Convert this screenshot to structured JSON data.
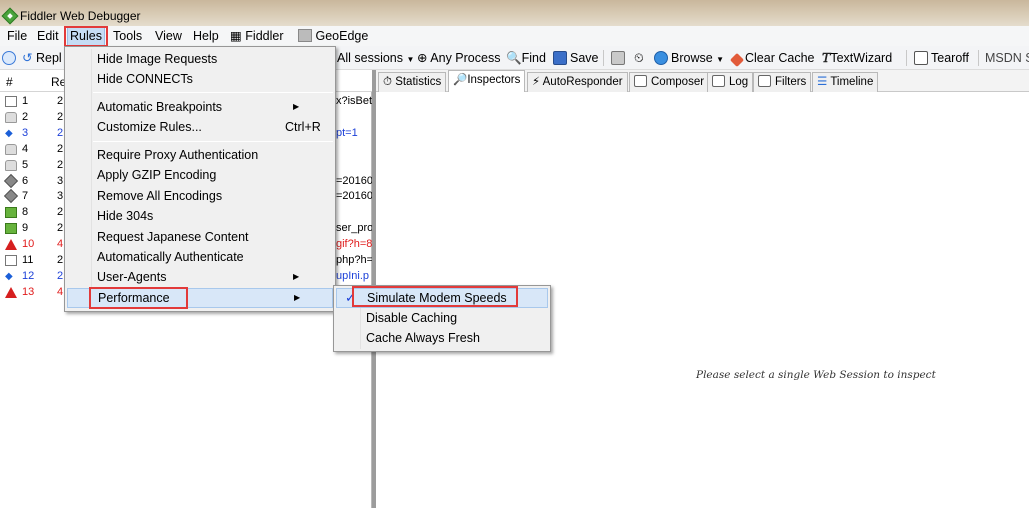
{
  "window": {
    "title": "Fiddler Web Debugger"
  },
  "menubar": [
    "File",
    "Edit",
    "Rules",
    "Tools",
    "View",
    "Help",
    "Fiddler",
    "GeoEdge"
  ],
  "toolbar": {
    "replay": "Repl",
    "sessions": "All sessions",
    "process": "Any Process",
    "find": "Find",
    "save": "Save",
    "browse": "Browse",
    "clear_cache": "Clear Cache",
    "textwizard": "TextWizard",
    "tearoff": "Tearoff",
    "msdn": "MSDN S"
  },
  "session_list": {
    "columns": [
      "#",
      "Re"
    ],
    "rows": [
      {
        "num": "1",
        "icon": "document-icon",
        "res": "2",
        "url": "x?isBet",
        "color": "black"
      },
      {
        "num": "2",
        "icon": "lock-icon",
        "res": "2",
        "url": "",
        "color": "black"
      },
      {
        "num": "3",
        "icon": "arrows-icon",
        "res": "2",
        "url": "pt=1",
        "color": "blue"
      },
      {
        "num": "4",
        "icon": "lock-icon",
        "res": "2",
        "url": "",
        "color": "black"
      },
      {
        "num": "5",
        "icon": "lock-icon",
        "res": "2",
        "url": "",
        "color": "black"
      },
      {
        "num": "6",
        "icon": "diamond-icon",
        "res": "3",
        "url": "=20160",
        "color": "black"
      },
      {
        "num": "7",
        "icon": "diamond-icon",
        "res": "3",
        "url": "=20160",
        "color": "black"
      },
      {
        "num": "8",
        "icon": "image-icon",
        "res": "2",
        "url": "",
        "color": "black"
      },
      {
        "num": "9",
        "icon": "image-icon",
        "res": "2",
        "url": "ser_pro",
        "color": "black"
      },
      {
        "num": "10",
        "icon": "warning-icon",
        "res": "4",
        "url": "gif?h=8",
        "color": "red"
      },
      {
        "num": "11",
        "icon": "document-icon",
        "res": "2",
        "url": "php?h=8",
        "color": "black"
      },
      {
        "num": "12",
        "icon": "arrows-icon",
        "res": "2",
        "url": "upIni.p",
        "color": "blue"
      },
      {
        "num": "13",
        "icon": "warning-icon",
        "res": "4",
        "url": "",
        "color": "red"
      }
    ]
  },
  "tabs": [
    "Statistics",
    "Inspectors",
    "AutoResponder",
    "Composer",
    "Log",
    "Filters",
    "Timeline"
  ],
  "inspector_hint": "Please select a single Web Session to inspect",
  "rules_menu": {
    "items": [
      {
        "label": "Hide Image Requests"
      },
      {
        "label": "Hide CONNECTs"
      },
      {
        "label": "Automatic Breakpoints",
        "submenu": true
      },
      {
        "label": "Customize Rules...",
        "shortcut": "Ctrl+R"
      },
      {
        "label": "Require Proxy Authentication"
      },
      {
        "label": "Apply GZIP Encoding"
      },
      {
        "label": "Remove All Encodings"
      },
      {
        "label": "Hide 304s"
      },
      {
        "label": "Request Japanese Content"
      },
      {
        "label": "Automatically Authenticate"
      },
      {
        "label": "User-Agents",
        "submenu": true
      },
      {
        "label": "Performance",
        "submenu": true
      }
    ]
  },
  "performance_menu": {
    "items": [
      {
        "label": "Simulate Modem Speeds",
        "checked": true
      },
      {
        "label": "Disable Caching"
      },
      {
        "label": "Cache Always Fresh"
      }
    ]
  },
  "colors": {
    "highlight_box": "#e23a3a",
    "link_blue": "#1b3fd8",
    "error_red": "#e01b1b"
  }
}
